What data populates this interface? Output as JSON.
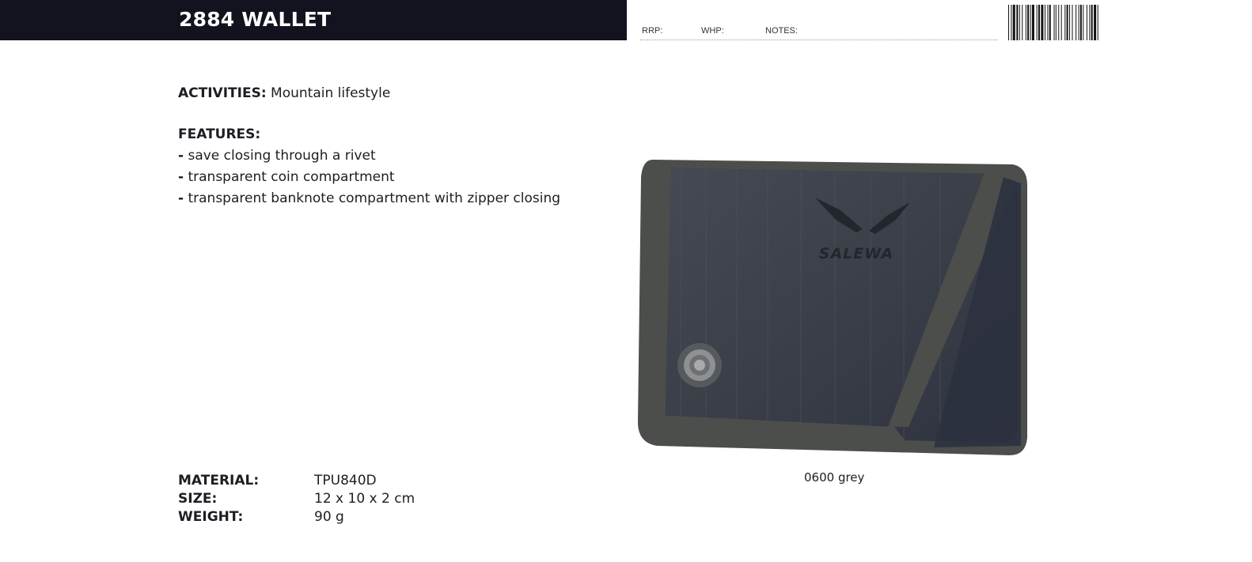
{
  "header": {
    "title": "2884 WALLET",
    "rrp_label": "RRP:",
    "whp_label": "WHP:",
    "notes_label": "NOTES:"
  },
  "activities": {
    "label": "ACTIVITIES:",
    "value": "Mountain lifestyle"
  },
  "features": {
    "label": "FEATURES:",
    "items": [
      "save closing through a rivet",
      "transparent coin compartment",
      "transparent banknote compartment with zipper closing"
    ]
  },
  "product": {
    "brand_text": "SALEWA",
    "color_caption": "0600 grey"
  },
  "specs": [
    {
      "label": "MATERIAL:",
      "value": "TPU840D"
    },
    {
      "label": "SIZE:",
      "value": "12 x 10 x 2 cm"
    },
    {
      "label": "WEIGHT:",
      "value": "90 g"
    }
  ],
  "colors": {
    "header_bg": "#12131f",
    "wallet_body": "#3a3e47",
    "wallet_trim": "#4b4e4a"
  }
}
